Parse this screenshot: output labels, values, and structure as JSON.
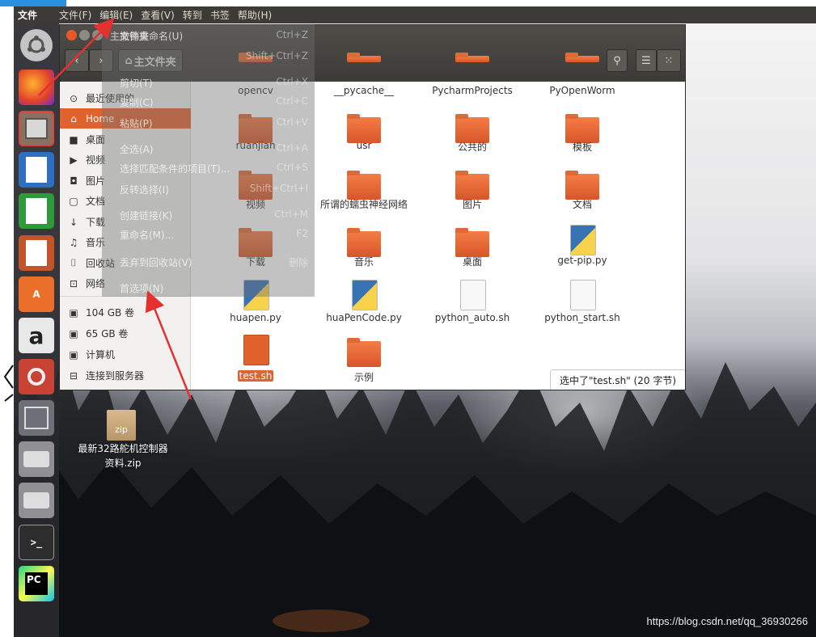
{
  "topbar": {
    "app": "文件",
    "menus": [
      "文件(F)",
      "编辑(E)",
      "查看(V)",
      "转到",
      "书签",
      "帮助(H)"
    ]
  },
  "window": {
    "title": "主文件夹",
    "path": "主文件夹"
  },
  "sidebar": {
    "items": [
      {
        "icon": "clock-icon",
        "glyph": "⊙",
        "label": "最近使用的"
      },
      {
        "icon": "home-icon",
        "glyph": "⌂",
        "label": "Home"
      },
      {
        "icon": "desktop-icon",
        "glyph": "■",
        "label": "桌面"
      },
      {
        "icon": "video-icon",
        "glyph": "▶",
        "label": "视频"
      },
      {
        "icon": "camera-icon",
        "glyph": "◘",
        "label": "图片"
      },
      {
        "icon": "document-icon",
        "glyph": "▢",
        "label": "文档"
      },
      {
        "icon": "download-icon",
        "glyph": "↓",
        "label": "下载"
      },
      {
        "icon": "music-icon",
        "glyph": "♫",
        "label": "音乐"
      },
      {
        "icon": "trash-icon",
        "glyph": "⌷",
        "label": "回收站"
      },
      {
        "icon": "network-icon",
        "glyph": "⊡",
        "label": "网络"
      },
      {
        "icon": "drive-icon",
        "glyph": "▣",
        "label": "104 GB 卷"
      },
      {
        "icon": "drive-icon",
        "glyph": "▣",
        "label": "65 GB 卷"
      },
      {
        "icon": "computer-icon",
        "glyph": "▣",
        "label": "计算机"
      },
      {
        "icon": "server-icon",
        "glyph": "⊟",
        "label": "连接到服务器"
      }
    ]
  },
  "files": [
    {
      "name": "opencv",
      "kind": "folder"
    },
    {
      "name": "__pycache__",
      "kind": "folder"
    },
    {
      "name": "PycharmProjects",
      "kind": "folder"
    },
    {
      "name": "PyOpenWorm",
      "kind": "folder"
    },
    {
      "name": "ruanjian",
      "kind": "folder"
    },
    {
      "name": "usr",
      "kind": "folder"
    },
    {
      "name": "公共的",
      "kind": "folder"
    },
    {
      "name": "模板",
      "kind": "folder"
    },
    {
      "name": "视频",
      "kind": "folder"
    },
    {
      "name": "所谓的蠕虫神经网络",
      "kind": "folder"
    },
    {
      "name": "图片",
      "kind": "folder"
    },
    {
      "name": "文档",
      "kind": "folder"
    },
    {
      "name": "下载",
      "kind": "folder"
    },
    {
      "name": "音乐",
      "kind": "folder"
    },
    {
      "name": "桌面",
      "kind": "folder"
    },
    {
      "name": "get-pip.py",
      "kind": "python"
    },
    {
      "name": "huapen.py",
      "kind": "python"
    },
    {
      "name": "huaPenCode.py",
      "kind": "python"
    },
    {
      "name": "python_auto.sh",
      "kind": "script"
    },
    {
      "name": "python_start.sh",
      "kind": "script"
    },
    {
      "name": "test.sh",
      "kind": "script",
      "selected": true
    },
    {
      "name": "示例",
      "kind": "folder"
    }
  ],
  "status": "选中了\"test.sh\" (20 字节)",
  "menu": {
    "items": [
      {
        "label": "撤销重命名(U)",
        "accel": "Ctrl+Z"
      },
      {
        "label": "",
        "accel": "Shift+Ctrl+Z"
      },
      {
        "label": "剪切(T)",
        "accel": "Ctrl+X"
      },
      {
        "label": "复制(C)",
        "accel": "Ctrl+C"
      },
      {
        "label": "粘贴(P)",
        "accel": "Ctrl+V"
      },
      {
        "label": "全选(A)",
        "accel": "Ctrl+A"
      },
      {
        "label": "选择匹配条件的项目(T)...",
        "accel": "Ctrl+S"
      },
      {
        "label": "反转选择(I)",
        "accel": "Shift+Ctrl+I"
      },
      {
        "label": "创建链接(K)",
        "accel": "Ctrl+M"
      },
      {
        "label": "重命名(M)...",
        "accel": "F2"
      },
      {
        "label": "丢弃到回收站(V)",
        "accel": "删除"
      },
      {
        "label": "首选项(N)",
        "accel": ""
      }
    ]
  },
  "desktop": {
    "zip_badge": "zip",
    "zip_label": "最新32路舵机控制器资料.zip"
  },
  "watermark": "https://blog.csdn.net/qq_36930266"
}
